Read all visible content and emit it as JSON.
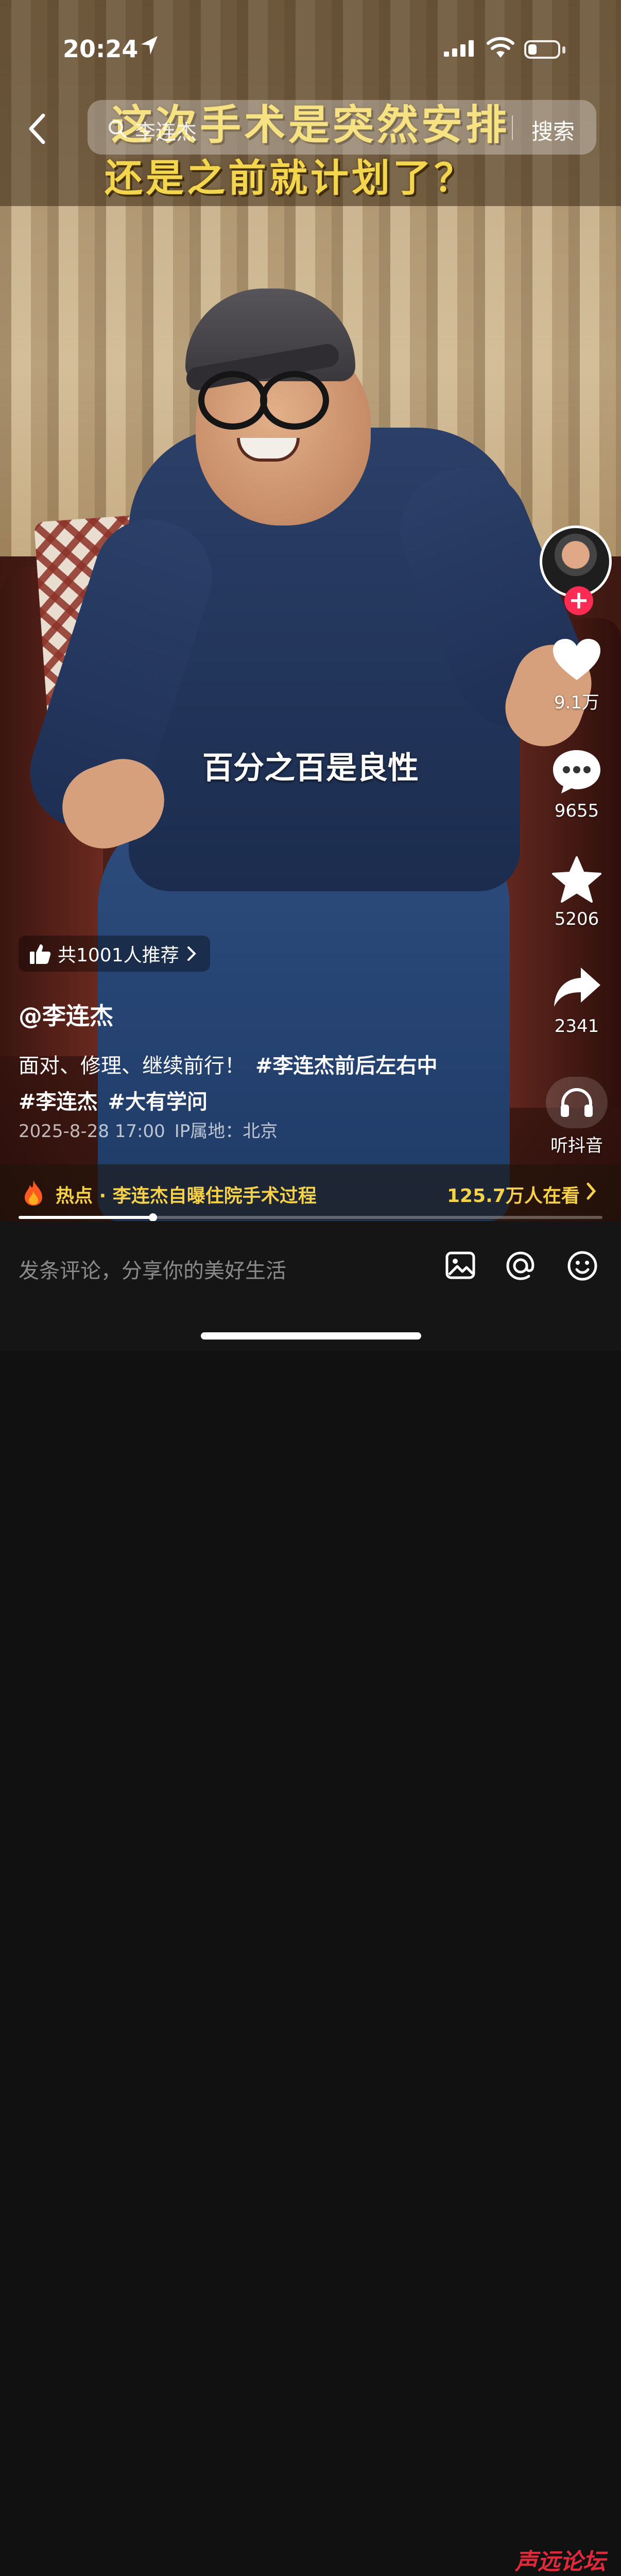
{
  "status_bar": {
    "time": "20:24",
    "battery_level": 0.3
  },
  "search": {
    "query": "李连杰",
    "button_label": "搜索"
  },
  "video": {
    "headline_line1": "这次手术是突然安排",
    "headline_line2": "还是之前就计划了？",
    "subtitle": "百分之百是良性"
  },
  "actions": {
    "likes": "9.1万",
    "comments": "9655",
    "favorites": "5206",
    "shares": "2341",
    "listen_label": "听抖音"
  },
  "post": {
    "recommend_label": "共1001人推荐",
    "author": "@李连杰",
    "caption_text": "面对、修理、继续前行！",
    "tags": [
      "#李连杰前后左右中",
      "#李连杰",
      "#大有学问"
    ],
    "date": "2025-8-28 17:00",
    "ip_location": "IP属地：北京"
  },
  "hot": {
    "topic": "热点 · 李连杰自曝住院手术过程",
    "viewers": "125.7万人在看"
  },
  "progress": {
    "fraction": 0.23
  },
  "comment_bar": {
    "placeholder": "发条评论，分享你的美好生活"
  },
  "watermark": "声远论坛",
  "colors": {
    "accent_red": "#fe2c55",
    "hot_yellow": "#f6d24a",
    "headline_yellow": "#f3d64d"
  }
}
